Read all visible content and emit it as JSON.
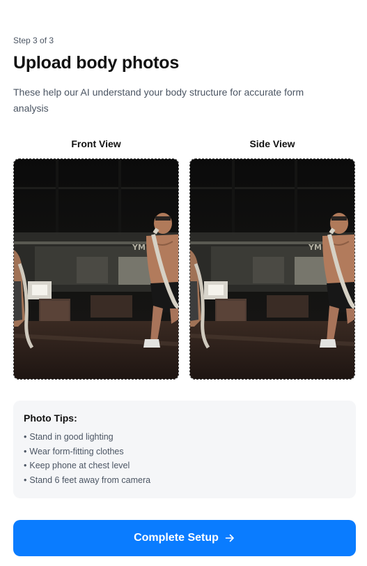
{
  "header": {
    "step": "Step 3 of 3",
    "title": "Upload body photos",
    "subtitle": "These help our AI understand your body structure for accurate form analysis"
  },
  "photos": [
    {
      "label": "Front View",
      "image": "gym-battle-rope-photo"
    },
    {
      "label": "Side View",
      "image": "gym-battle-rope-photo"
    }
  ],
  "tips": {
    "title": "Photo Tips:",
    "items": [
      "Stand in good lighting",
      "Wear form-fitting clothes",
      "Keep phone at chest level",
      "Stand 6 feet away from camera"
    ],
    "bullet": "•"
  },
  "cta": {
    "label": "Complete Setup",
    "icon": "arrow-right-icon",
    "color": "#0a7cff"
  }
}
